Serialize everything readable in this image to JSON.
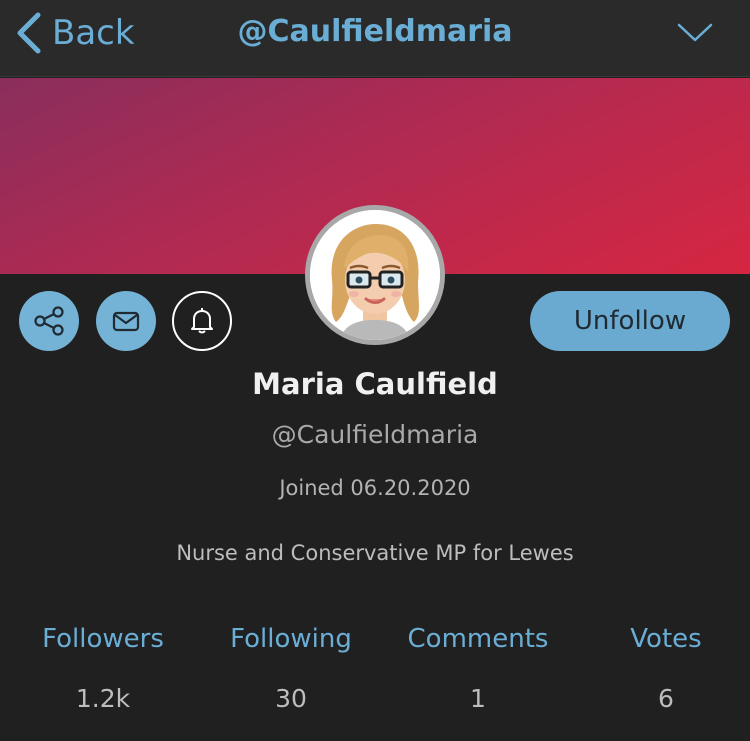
{
  "header": {
    "back_label": "Back",
    "title": "@Caulfieldmaria",
    "menu_icon": "chevron-down-icon"
  },
  "banner": {
    "gradient_colors": [
      "#8a2e5c",
      "#d62641"
    ]
  },
  "actions": {
    "share_icon": "share-icon",
    "message_icon": "mail-icon",
    "notify_icon": "bell-icon",
    "unfollow_label": "Unfollow"
  },
  "profile": {
    "name": "Maria Caulfield",
    "handle": "@Caulfieldmaria",
    "joined": "Joined 06.20.2020",
    "bio": "Nurse and Conservative MP for Lewes"
  },
  "stats": [
    {
      "label": "Followers",
      "value": "1.2k"
    },
    {
      "label": "Following",
      "value": "30"
    },
    {
      "label": "Comments",
      "value": "1"
    },
    {
      "label": "Votes",
      "value": "6"
    }
  ],
  "colors": {
    "accent": "#6aaed6",
    "background": "#202020",
    "button": "#6aaad0"
  }
}
